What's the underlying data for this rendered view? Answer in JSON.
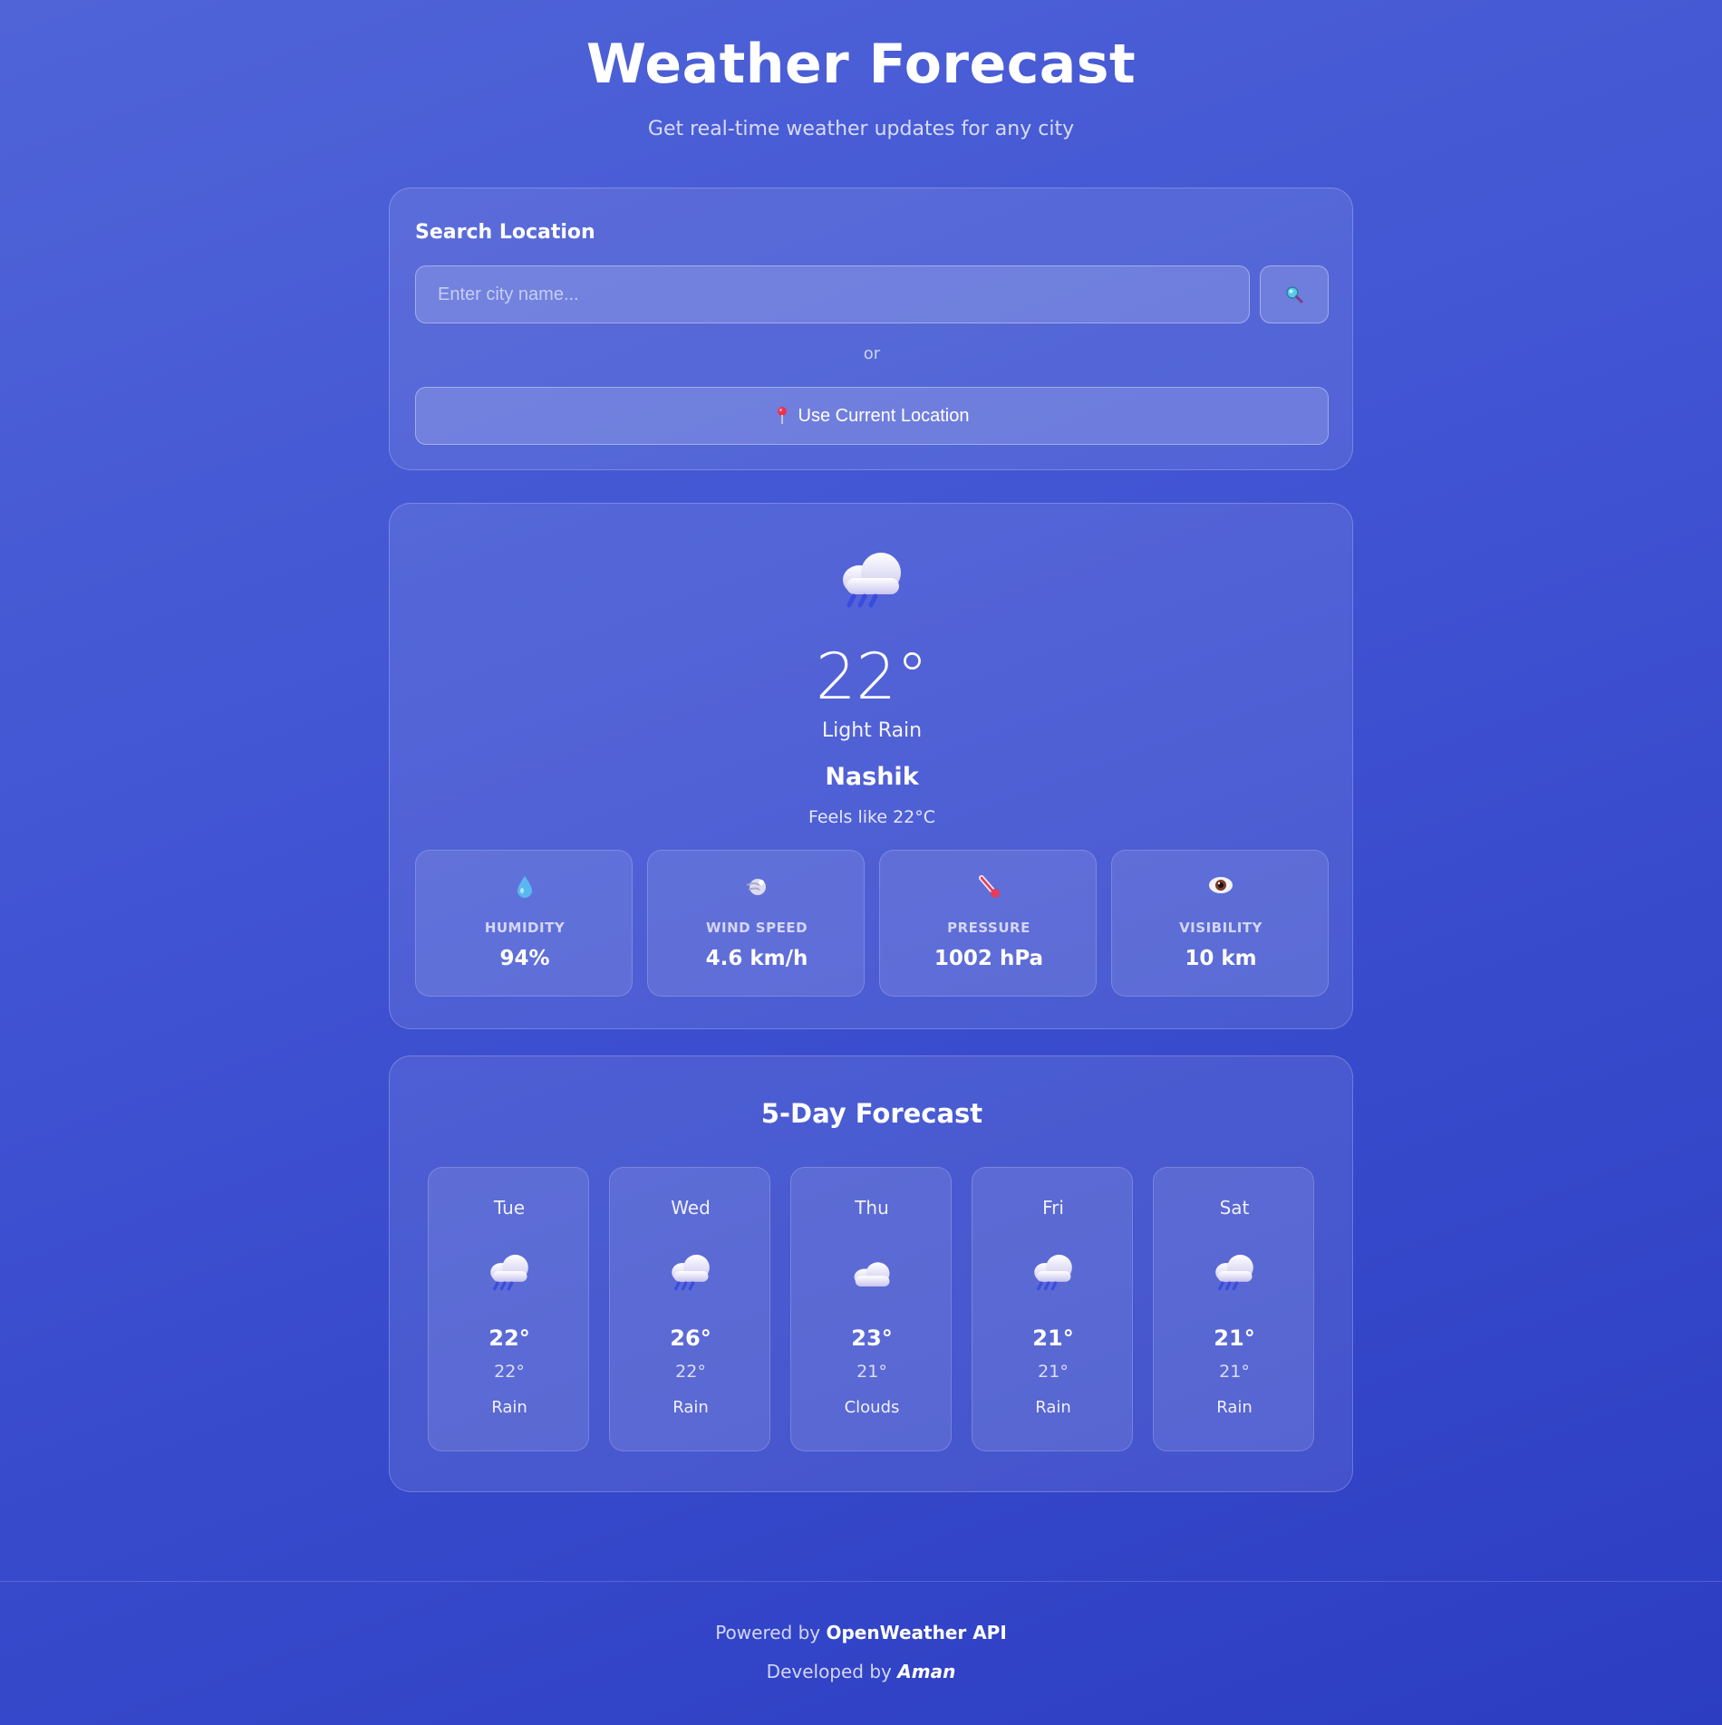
{
  "header": {
    "title": "Weather Forecast",
    "subtitle": "Get real-time weather updates for any city"
  },
  "search": {
    "title": "Search Location",
    "placeholder": "Enter city name...",
    "search_icon": "search-icon",
    "or_text": "or",
    "location_button_label": "Use Current Location",
    "location_icon": "pin-icon"
  },
  "current": {
    "icon": "rain-cloud-icon",
    "temperature": "22°",
    "description": "Light Rain",
    "city": "Nashik",
    "feels_like": "Feels like 22°C",
    "stats": [
      {
        "icon": "droplet-icon",
        "label": "HUMIDITY",
        "value": "94%"
      },
      {
        "icon": "wind-icon",
        "label": "WIND SPEED",
        "value": "4.6 km/h"
      },
      {
        "icon": "thermometer-icon",
        "label": "PRESSURE",
        "value": "1002 hPa"
      },
      {
        "icon": "eye-icon",
        "label": "VISIBILITY",
        "value": "10 km"
      }
    ]
  },
  "forecast": {
    "title": "5-Day Forecast",
    "days": [
      {
        "day": "Tue",
        "icon": "rain-cloud-icon",
        "high": "22°",
        "low": "22°",
        "condition": "Rain"
      },
      {
        "day": "Wed",
        "icon": "rain-cloud-icon",
        "high": "26°",
        "low": "22°",
        "condition": "Rain"
      },
      {
        "day": "Thu",
        "icon": "cloud-icon",
        "high": "23°",
        "low": "21°",
        "condition": "Clouds"
      },
      {
        "day": "Fri",
        "icon": "rain-cloud-icon",
        "high": "21°",
        "low": "21°",
        "condition": "Rain"
      },
      {
        "day": "Sat",
        "icon": "rain-cloud-icon",
        "high": "21°",
        "low": "21°",
        "condition": "Rain"
      }
    ]
  },
  "footer": {
    "powered_prefix": "Powered by",
    "powered_name": "OpenWeather API",
    "developed_prefix": "Developed by",
    "developer": "Aman"
  },
  "colors": {
    "background_start": "#5064d8",
    "background_end": "#2c3dc2"
  }
}
